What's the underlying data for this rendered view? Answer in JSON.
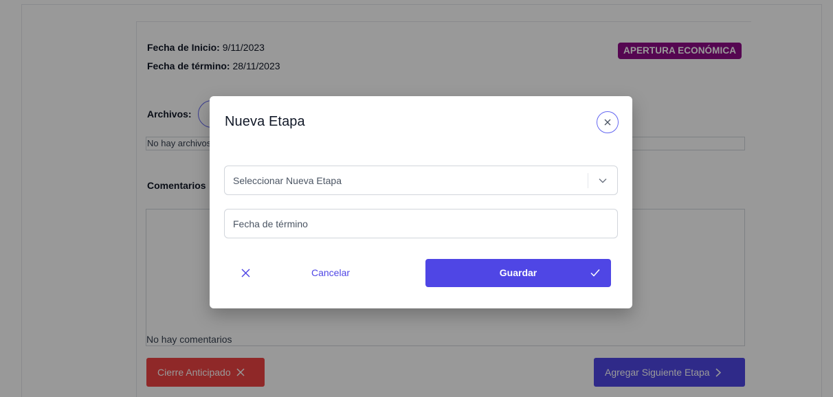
{
  "stage": {
    "start_label": "Fecha de Inicio:",
    "start_value": "9/11/2023",
    "end_label": "Fecha de término:",
    "end_value": "28/11/2023",
    "badge": "APERTURA ECONÓMICA",
    "files_label": "Archivos:",
    "files_empty": "No hay archivos",
    "comments_label": "Comentarios",
    "comments_empty": "No hay comentarios",
    "early_close_button": "Cierre Anticipado",
    "add_next_stage_button": "Agregar Siguiente Etapa"
  },
  "modal": {
    "title": "Nueva Etapa",
    "stage_select_placeholder": "Seleccionar Nueva Etapa",
    "end_date_placeholder": "Fecha de término",
    "cancel_label": "Cancelar",
    "save_label": "Guardar"
  },
  "colors": {
    "primary": "#4f46e5",
    "danger": "#ef4444",
    "badge": "#8e0a88",
    "overlay": "rgba(0,0,0,0.4)"
  },
  "icons": {
    "close": "close-icon",
    "chevron": "chevron-down-icon",
    "cancel": "x-icon",
    "save": "check-icon",
    "next": "chevron-right-icon"
  }
}
